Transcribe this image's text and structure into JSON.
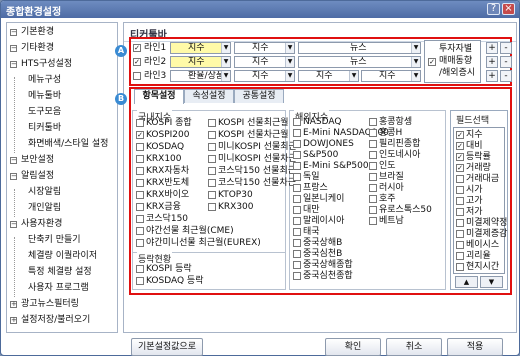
{
  "window": {
    "title": "종합환경설정",
    "help_label": "?",
    "close_label": "×"
  },
  "tree": [
    {
      "label": "기본환경",
      "type": "node",
      "icon": "minus"
    },
    {
      "label": "기타환경",
      "type": "node",
      "icon": "minus"
    },
    {
      "label": "HTS구성설정",
      "type": "node",
      "icon": "minus"
    },
    {
      "label": "메뉴구성",
      "type": "child"
    },
    {
      "label": "메뉴툴바",
      "type": "child"
    },
    {
      "label": "도구모음",
      "type": "child"
    },
    {
      "label": "티커툴바",
      "type": "child"
    },
    {
      "label": "화면배색/스타일 설정",
      "type": "child"
    },
    {
      "label": "보안설정",
      "type": "node",
      "icon": "minus"
    },
    {
      "label": "알림설정",
      "type": "node",
      "icon": "minus"
    },
    {
      "label": "시장알림",
      "type": "child"
    },
    {
      "label": "개인알림",
      "type": "child"
    },
    {
      "label": "사용자환경",
      "type": "node",
      "icon": "minus"
    },
    {
      "label": "단축키 만들기",
      "type": "child"
    },
    {
      "label": "체결량 이퀄라이저",
      "type": "child"
    },
    {
      "label": "특정 체결량 설정",
      "type": "child"
    },
    {
      "label": "사용자 프로그램",
      "type": "child"
    },
    {
      "label": "광고뉴스필터링",
      "type": "node",
      "icon": "plus"
    },
    {
      "label": "설정저장/불러오기",
      "type": "node",
      "icon": "plus"
    }
  ],
  "panel_title": "티커툴바",
  "badge_a": "A",
  "badge_b": "B",
  "lines": [
    {
      "label": "라인1",
      "checked": true,
      "s1": "지수",
      "s2": "지수",
      "s3": "뉴스",
      "s4": ""
    },
    {
      "label": "라인2",
      "checked": true,
      "s1": "지수",
      "s2": "지수",
      "s3": "뉴스",
      "s4": ""
    },
    {
      "label": "라인3",
      "checked": false,
      "s1": "환율/상품",
      "s2": "지수",
      "s3": "지수",
      "s4": "지수"
    }
  ],
  "investor_fix": {
    "label1": "투자자별",
    "label2": "매매동향",
    "label3": "/해외증시",
    "checked": true
  },
  "plus_label": "+",
  "minus_label": "-",
  "tabs": [
    "항목설정",
    "속성설정",
    "공통설정"
  ],
  "domestic": {
    "title": "국내지수",
    "col1": [
      {
        "label": "KOSPI 종합",
        "checked": false
      },
      {
        "label": "KOSPI200",
        "checked": true
      },
      {
        "label": "KOSDAQ",
        "checked": false
      },
      {
        "label": "KRX100",
        "checked": false
      },
      {
        "label": "KRX자동차",
        "checked": false
      },
      {
        "label": "KRX반도체",
        "checked": false
      },
      {
        "label": "KRX바이오",
        "checked": false
      },
      {
        "label": "KRX금융",
        "checked": false
      },
      {
        "label": "코스닥150",
        "checked": false
      },
      {
        "label": "야간선물 최근월(CME)",
        "checked": false
      },
      {
        "label": "야간미니선물 최근월(EUREX)",
        "checked": false
      }
    ],
    "col2": [
      {
        "label": "KOSPI 선물최근월",
        "checked": false
      },
      {
        "label": "KOSPI 선물차근월",
        "checked": false
      },
      {
        "label": "미니KOSPI 선물최근",
        "checked": false
      },
      {
        "label": "미니KOSPI 선물차근",
        "checked": false
      },
      {
        "label": "코스닥150 선물최근",
        "checked": false
      },
      {
        "label": "코스닥150 선물차근",
        "checked": false
      },
      {
        "label": "KTOP30",
        "checked": false
      },
      {
        "label": "KRX300",
        "checked": false
      }
    ]
  },
  "trading": {
    "title": "등락현황",
    "items": [
      {
        "label": "KOSPI 등락",
        "checked": false
      },
      {
        "label": "KOSDAQ 등락",
        "checked": false
      }
    ]
  },
  "overseas": {
    "title": "해외지수",
    "col1": [
      {
        "label": "NASDAQ",
        "checked": false
      },
      {
        "label": "E-Mini NASDAQ100",
        "checked": false
      },
      {
        "label": "DOWJONES",
        "checked": false
      },
      {
        "label": "S&P500",
        "checked": false
      },
      {
        "label": "E-Mini S&P500",
        "checked": false
      },
      {
        "label": "독일",
        "checked": false
      },
      {
        "label": "프랑스",
        "checked": false
      },
      {
        "label": "일본니케이",
        "checked": false
      },
      {
        "label": "대만",
        "checked": false
      },
      {
        "label": "말레이시아",
        "checked": false
      },
      {
        "label": "태국",
        "checked": false
      },
      {
        "label": "중국상해B",
        "checked": false
      },
      {
        "label": "중국심천B",
        "checked": false
      },
      {
        "label": "중국상해종합",
        "checked": false
      },
      {
        "label": "중국심천종합",
        "checked": false
      }
    ],
    "col2": [
      {
        "label": "홍콩항셍",
        "checked": false
      },
      {
        "label": "홍콩H",
        "checked": false
      },
      {
        "label": "필리핀종합",
        "checked": false
      },
      {
        "label": "인도네시아",
        "checked": false
      },
      {
        "label": "인도",
        "checked": false
      },
      {
        "label": "브라질",
        "checked": false
      },
      {
        "label": "러시아",
        "checked": false
      },
      {
        "label": "호주",
        "checked": false
      },
      {
        "label": "유로스톡스50",
        "checked": false
      },
      {
        "label": "베트남",
        "checked": false
      }
    ]
  },
  "fields": {
    "title": "필드선택",
    "items": [
      {
        "label": "지수",
        "checked": true
      },
      {
        "label": "대비",
        "checked": true
      },
      {
        "label": "등락률",
        "checked": true
      },
      {
        "label": "거래량",
        "checked": true
      },
      {
        "label": "거래대금",
        "checked": false
      },
      {
        "label": "시가",
        "checked": false
      },
      {
        "label": "고가",
        "checked": false
      },
      {
        "label": "저가",
        "checked": false
      },
      {
        "label": "미결제약정",
        "checked": false
      },
      {
        "label": "미결제증감",
        "checked": false
      },
      {
        "label": "베이시스",
        "checked": false
      },
      {
        "label": "괴리율",
        "checked": false
      },
      {
        "label": "현지시간",
        "checked": false
      }
    ],
    "up_label": "▲",
    "down_label": "▼"
  },
  "buttons": {
    "default": "기본설정값으로",
    "ok": "확인",
    "cancel": "취소",
    "apply": "적용"
  },
  "colors": {
    "highlight_border": "#e01010",
    "badge": "#3a8bd3",
    "title_bar": "#5a78ae",
    "selected_select": "#fffaa8"
  }
}
